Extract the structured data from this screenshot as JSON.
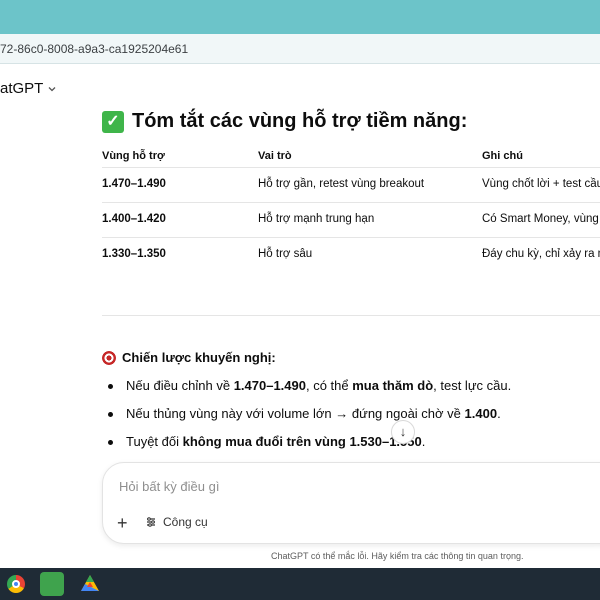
{
  "browser": {
    "url_fragment": "72-86c0-8008-a9a3-ca1925204e61"
  },
  "app": {
    "name": "atGPT"
  },
  "heading": {
    "emoji": "✅",
    "text": "Tóm tắt các vùng hỗ trợ tiềm năng:"
  },
  "table": {
    "headers": [
      "Vùng hỗ trợ",
      "Vai trò",
      "Ghi chú"
    ],
    "rows": [
      [
        "1.470–1.490",
        "Hỗ trợ gần, retest vùng breakout",
        "Vùng chốt lời + test cầu"
      ],
      [
        "1.400–1.420",
        "Hỗ trợ mạnh trung hạn",
        "Có Smart Money, vùng t"
      ],
      [
        "1.330–1.350",
        "Hỗ trợ sâu",
        "Đáy chu kỳ, chỉ xảy ra nế"
      ]
    ]
  },
  "strategy": {
    "title": "Chiến lược khuyến nghị:",
    "bullets": [
      {
        "pre": "Nếu điều chỉnh về ",
        "b1": "1.470–1.490",
        "mid": ", có thể ",
        "b2": "mua thăm dò",
        "post": ", test lực cầu."
      },
      {
        "pre": "Nếu thủng vùng này với volume lớn → đứng ngoài chờ về ",
        "b1": "1.400",
        "mid": ".",
        "b2": "",
        "post": ""
      },
      {
        "pre": "Tuyệt đối ",
        "b1": "không mua đuổi trên vùng 1.530–1.550",
        "mid": ".",
        "b2": "",
        "post": ""
      }
    ]
  },
  "composer": {
    "placeholder": "Hỏi bất kỳ điều gì",
    "tools_label": "Công cụ"
  },
  "disclaimer": "ChatGPT có thể mắc lỗi. Hãy kiểm tra các thông tin quan trọng.",
  "colors": {
    "taskbar": "#1f2b36",
    "topstrip": "#6cc4c9",
    "check": "#3fb54a"
  },
  "icons": [
    "check-icon",
    "target-icon",
    "chevron-down-icon",
    "arrow-down-icon",
    "plus-icon",
    "tools-icon",
    "chrome-icon",
    "app-icon",
    "drive-icon"
  ]
}
